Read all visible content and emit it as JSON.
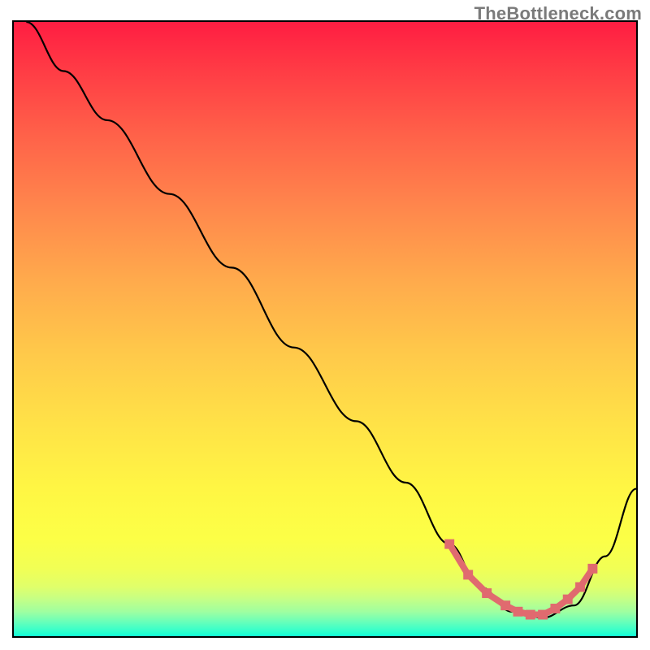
{
  "watermark": "TheBottleneck.com",
  "chart_data": {
    "type": "line",
    "title": "",
    "xlabel": "",
    "ylabel": "",
    "xlim": [
      0,
      100
    ],
    "ylim": [
      0,
      100
    ],
    "series": [
      {
        "name": "main-curve",
        "x": [
          2,
          8,
          15,
          25,
          35,
          45,
          55,
          63,
          70,
          75,
          80,
          85,
          90,
          95,
          100
        ],
        "y": [
          100,
          92,
          84,
          72,
          60,
          47,
          35,
          25,
          15,
          8,
          4,
          3,
          5,
          13,
          24
        ]
      },
      {
        "name": "highlight-segment",
        "x": [
          70,
          73,
          76,
          79,
          81,
          83,
          85,
          87,
          89,
          91,
          93
        ],
        "y": [
          15,
          10,
          7,
          5,
          4,
          3.5,
          3.5,
          4.5,
          6,
          8,
          11
        ]
      }
    ],
    "gradient_stops": [
      {
        "pos": 0,
        "color": "#ff1d42"
      },
      {
        "pos": 50,
        "color": "#ffc94a"
      },
      {
        "pos": 85,
        "color": "#fcff46"
      },
      {
        "pos": 100,
        "color": "#12ffd6"
      }
    ]
  }
}
